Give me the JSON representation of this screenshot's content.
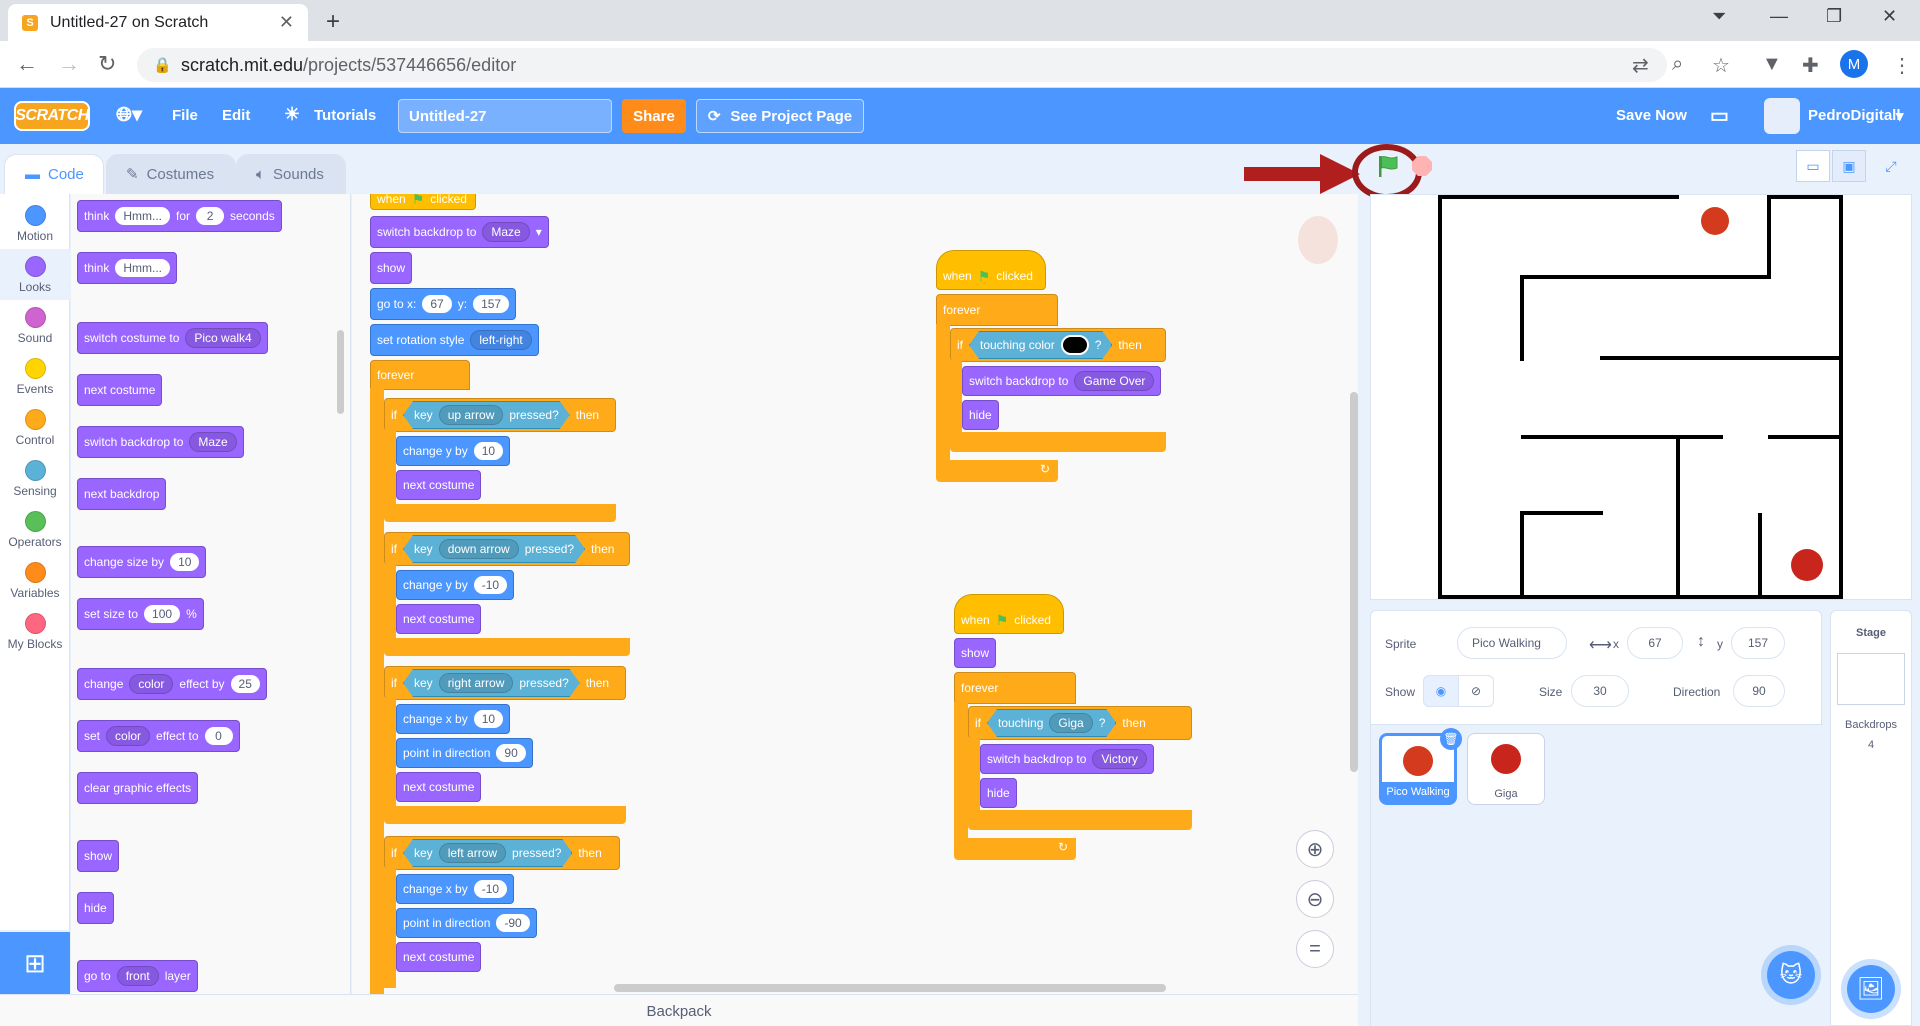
{
  "browser": {
    "tab_title": "Untitled-27 on Scratch",
    "url_host": "scratch.mit.edu",
    "url_path": "/projects/537446656/editor",
    "profile_initial": "M"
  },
  "menu": {
    "logo": "SCRATCH",
    "file": "File",
    "edit": "Edit",
    "tutorials": "Tutorials",
    "project_title": "Untitled-27",
    "share": "Share",
    "see_project": "See Project Page",
    "save_now": "Save Now",
    "username": "PedroDigitall"
  },
  "tabs": {
    "code": "Code",
    "costumes": "Costumes",
    "sounds": "Sounds"
  },
  "categories": [
    {
      "label": "Motion",
      "color": "#4c97ff"
    },
    {
      "label": "Looks",
      "color": "#9966ff"
    },
    {
      "label": "Sound",
      "color": "#cf63cf"
    },
    {
      "label": "Events",
      "color": "#ffd500"
    },
    {
      "label": "Control",
      "color": "#ffab19"
    },
    {
      "label": "Sensing",
      "color": "#5cb1d6"
    },
    {
      "label": "Operators",
      "color": "#59c059"
    },
    {
      "label": "Variables",
      "color": "#ff8c1a"
    },
    {
      "label": "My Blocks",
      "color": "#ff6680"
    }
  ],
  "palette": {
    "think_for": {
      "think": "think",
      "msg": "Hmm...",
      "for": "for",
      "secs": "2",
      "seconds": "seconds"
    },
    "think": {
      "think": "think",
      "msg": "Hmm..."
    },
    "switch_costume": {
      "label": "switch costume to",
      "value": "Pico walk4"
    },
    "next_costume": "next costume",
    "switch_backdrop": {
      "label": "switch backdrop to",
      "value": "Maze"
    },
    "next_backdrop": "next backdrop",
    "change_size": {
      "label": "change size by",
      "value": "10"
    },
    "set_size": {
      "label": "set size to",
      "value": "100",
      "unit": "%"
    },
    "change_effect": {
      "change": "change",
      "effect": "color",
      "by": "effect by",
      "value": "25"
    },
    "set_effect": {
      "set": "set",
      "effect": "color",
      "to": "effect to",
      "value": "0"
    },
    "clear_effects": "clear graphic effects",
    "show": "show",
    "hide": "hide",
    "go_to_layer": {
      "go": "go to",
      "value": "front",
      "layer": "layer"
    }
  },
  "script1": {
    "when": "when",
    "clicked": "clicked",
    "switch_backdrop": "switch backdrop to",
    "backdrop": "Maze",
    "show": "show",
    "goto": "go to x:",
    "x": "67",
    "y_label": "y:",
    "y": "157",
    "rotation": "set rotation style",
    "rotation_value": "left-right",
    "forever": "forever",
    "if": "if",
    "key": "key",
    "pressed": "pressed?",
    "then": "then",
    "up": "up arrow",
    "down": "down arrow",
    "right": "right arrow",
    "left": "left arrow",
    "change_y": "change y by",
    "up_val": "10",
    "down_val": "-10",
    "change_x": "change x by",
    "right_val": "10",
    "left_val": "-10",
    "next_costume": "next costume",
    "point_dir": "point in direction",
    "dir_right": "90",
    "dir_left": "-90"
  },
  "script2": {
    "when": "when",
    "clicked": "clicked",
    "forever": "forever",
    "if": "if",
    "touching_color": "touching color",
    "q": "?",
    "then": "then",
    "switch_backdrop": "switch backdrop to",
    "backdrop": "Game Over",
    "hide": "hide"
  },
  "script3": {
    "when": "when",
    "clicked": "clicked",
    "show": "show",
    "forever": "forever",
    "if": "if",
    "touching": "touching",
    "target": "Giga",
    "q": "?",
    "then": "then",
    "switch_backdrop": "switch backdrop to",
    "backdrop": "Victory",
    "hide": "hide"
  },
  "backpack": "Backpack",
  "sprite_info": {
    "sprite_label": "Sprite",
    "sprite_name": "Pico Walking",
    "x_label": "x",
    "x": "67",
    "y_label": "y",
    "y": "157",
    "show_label": "Show",
    "size_label": "Size",
    "size": "30",
    "direction_label": "Direction",
    "direction": "90"
  },
  "sprites": [
    {
      "name": "Pico Walking",
      "selected": true
    },
    {
      "name": "Giga",
      "selected": false
    }
  ],
  "stage_panel": {
    "title": "Stage",
    "backdrops_label": "Backdrops",
    "backdrops_count": "4"
  }
}
